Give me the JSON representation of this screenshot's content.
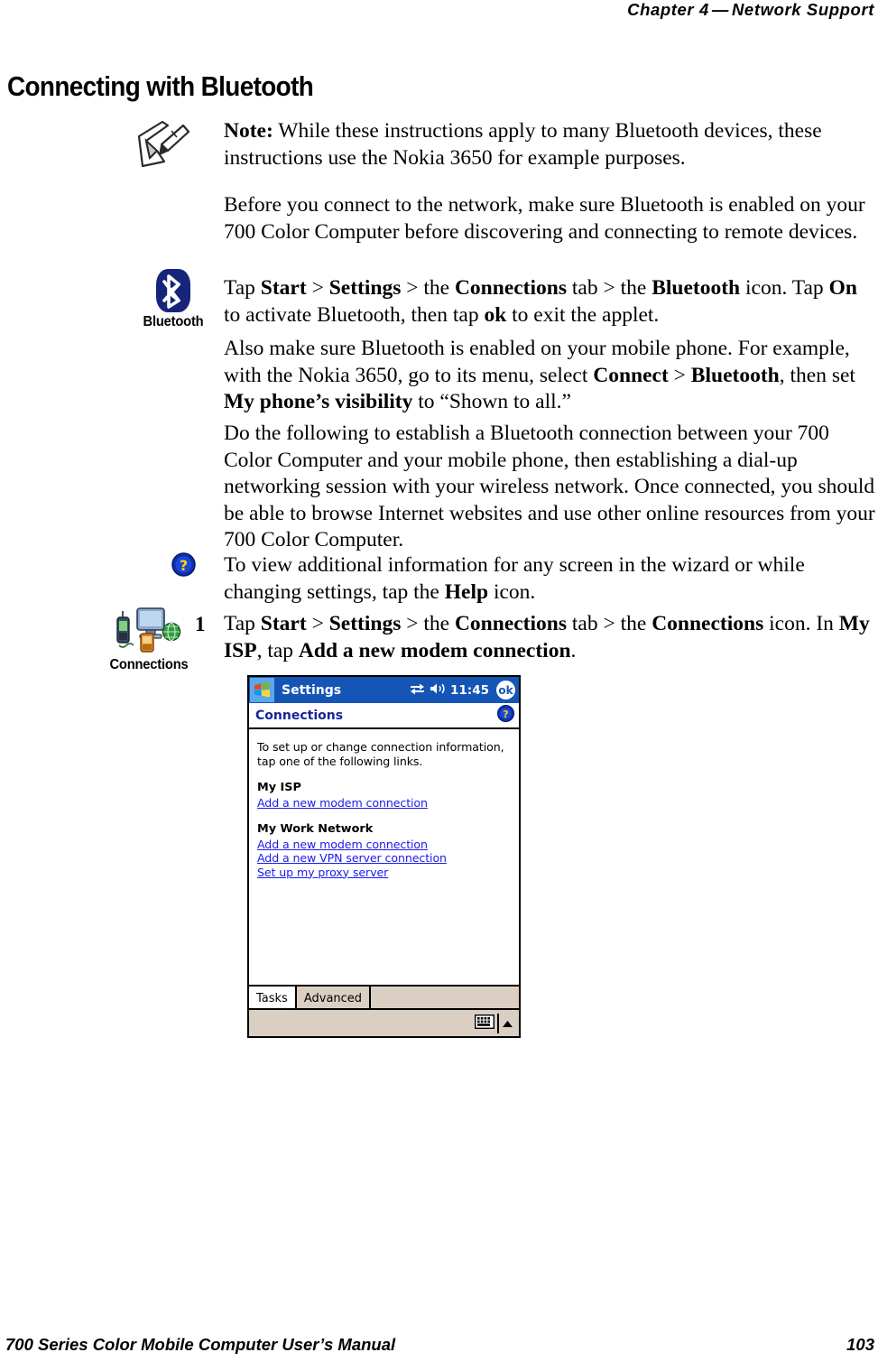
{
  "header": {
    "chapter": "Chapter  4",
    "dash": "—",
    "title": "Network Support"
  },
  "heading": "Connecting with Bluetooth",
  "paragraphs": {
    "note_label": "Note:",
    "note_text": " While these instructions apply to many Bluetooth devices, these instructions use the Nokia 3650 for example purposes.",
    "before": "Before you connect to the network, make sure Bluetooth is enabled on your 700 Color Computer before discovering and connecting to remote devices.",
    "tap_pre": "Tap ",
    "tap_start": "Start",
    "tap_gt1": " > ",
    "tap_settings": "Settings",
    "tap_gt2": " > the ",
    "tap_connections": "Connections",
    "tap_tab": " tab > the ",
    "tap_bluetooth": "Bluetooth",
    "tap_icon": " icon. Tap ",
    "tap_on": "On",
    "tap_mid": " to activate Bluetooth, then tap ",
    "tap_ok": "ok",
    "tap_end": " to exit the applet.",
    "also_pre": "Also make sure Bluetooth is enabled on your mobile phone. For example, with the Nokia 3650, go to its menu, select ",
    "also_connect": "Connect",
    "also_gt": " > ",
    "also_bluetooth": "Bluetooth",
    "also_mid": ", then set ",
    "also_visibility": "My phone’s visibility",
    "also_end": " to “Shown to all.”",
    "do_following": "Do the following to establish a Bluetooth connection between your 700 Color Computer and your mobile phone, then establishing a dial-up networking session with your wireless network. Once connected, you should be able to browse Internet websites and use other online resources from your 700 Color Computer.",
    "toview_pre": "To view additional information for any screen in the wizard or while changing settings, tap the ",
    "toview_help": "Help",
    "toview_end": " icon."
  },
  "step1": {
    "number": "1",
    "pre": "Tap ",
    "start": "Start",
    "gt1": " > ",
    "settings": "Settings",
    "gt2": " > the ",
    "connections_tab": "Connections",
    "tab_text": " tab > the ",
    "connections_icon": "Connections",
    "icon_text": " icon. In ",
    "my_isp": "My ISP",
    "tap_text": ", tap ",
    "add_modem": "Add a new modem connection",
    "period": "."
  },
  "margin_icons": {
    "note": "note-pencil-icon",
    "bluetooth_caption": "Bluetooth",
    "help": "help-question-icon",
    "connections_caption": "Connections"
  },
  "pda": {
    "title": "Settings",
    "clock": "11:45",
    "ok_label": "ok",
    "screen_title": "Connections",
    "intro_line1": "To set up or change connection information,",
    "intro_line2": "tap one of the following links.",
    "groups": [
      {
        "title": "My ISP",
        "links": [
          "Add a new modem connection"
        ]
      },
      {
        "title": "My Work Network",
        "links": [
          "Add a new modem connection",
          "Add a new VPN server connection",
          "Set up my proxy server"
        ]
      }
    ],
    "tabs": [
      {
        "label": "Tasks",
        "active": true
      },
      {
        "label": "Advanced",
        "active": false
      }
    ]
  },
  "footer": {
    "title": "700 Series Color Mobile Computer User’s Manual",
    "page": "103"
  },
  "colors": {
    "titlebar": "#1555b5",
    "link": "#1a1aee",
    "screen_title": "#15259b",
    "chrome": "#dbcec3",
    "bluetooth_badge": "#16257a"
  }
}
